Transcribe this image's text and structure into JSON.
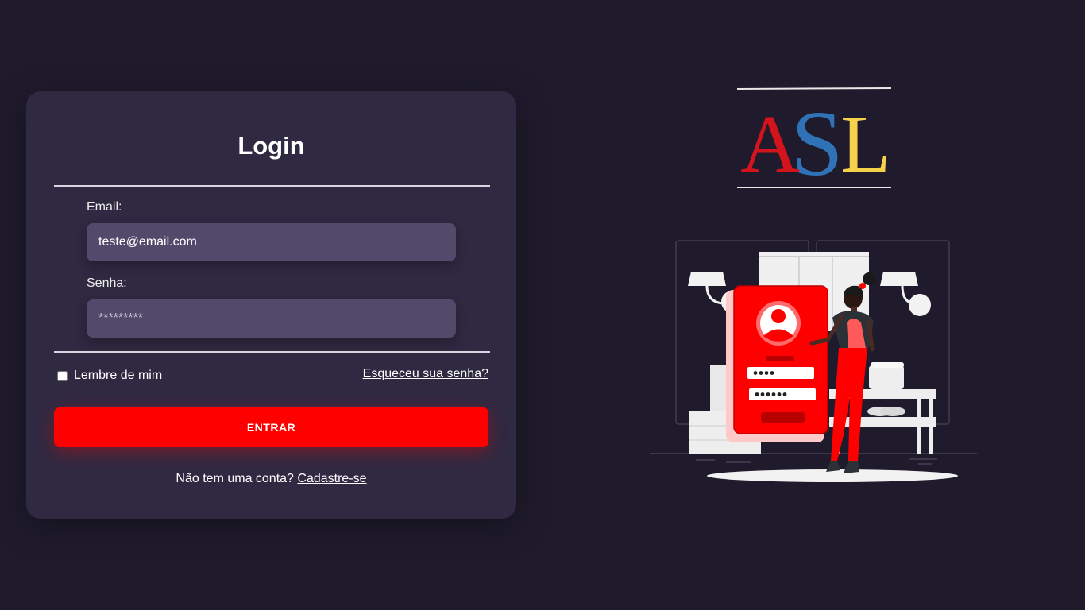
{
  "login": {
    "title": "Login",
    "email_label": "Email:",
    "email_value": "teste@email.com",
    "password_label": "Senha:",
    "password_value": "*********",
    "remember_label": "Lembre de mim",
    "forgot_link": "Esqueceu sua senha?",
    "submit_label": "ENTRAR",
    "signup_prompt": "Não tem uma conta?",
    "signup_link": "Cadastre-se"
  },
  "logo": {
    "letters": [
      "A",
      "S",
      "L"
    ],
    "colors": [
      "#d4141c",
      "#2f72b6",
      "#f5d24a"
    ]
  },
  "illustration": {
    "icon": "mobile-login-illustration",
    "accent": "#ff0000"
  },
  "colors": {
    "background": "#1f1b2d",
    "card": "#2f2941",
    "input": "#534a6b",
    "accent": "#ff0000"
  }
}
